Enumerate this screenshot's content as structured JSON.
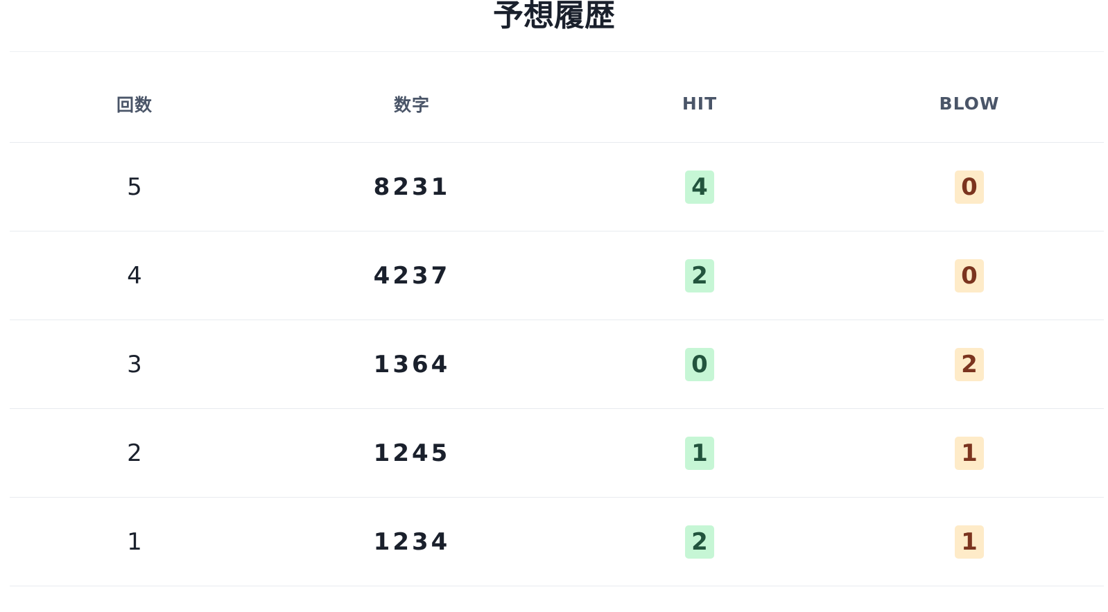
{
  "page": {
    "title": "予想履歴"
  },
  "table": {
    "headers": {
      "round": "回数",
      "number": "数字",
      "hit": "HIT",
      "blow": "BLOW"
    },
    "rows": [
      {
        "round": "5",
        "number": "8231",
        "hit": "4",
        "blow": "0"
      },
      {
        "round": "4",
        "number": "4237",
        "hit": "2",
        "blow": "0"
      },
      {
        "round": "3",
        "number": "1364",
        "hit": "0",
        "blow": "2"
      },
      {
        "round": "2",
        "number": "1245",
        "hit": "1",
        "blow": "1"
      },
      {
        "round": "1",
        "number": "1234",
        "hit": "2",
        "blow": "1"
      }
    ]
  },
  "colors": {
    "hit_badge_bg": "#c6f6d5",
    "hit_badge_text": "#22543d",
    "blow_badge_bg": "#feebc8",
    "blow_badge_text": "#7b341e"
  }
}
